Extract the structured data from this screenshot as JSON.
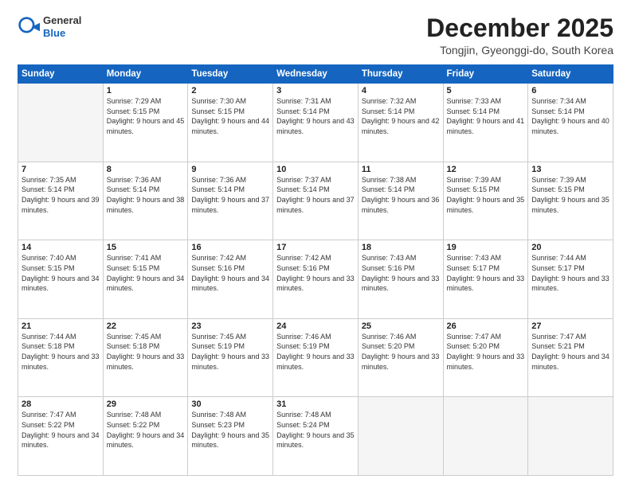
{
  "header": {
    "logo": {
      "general": "General",
      "blue": "Blue"
    },
    "title": "December 2025",
    "subtitle": "Tongjin, Gyeonggi-do, South Korea"
  },
  "calendar": {
    "days_of_week": [
      "Sunday",
      "Monday",
      "Tuesday",
      "Wednesday",
      "Thursday",
      "Friday",
      "Saturday"
    ],
    "weeks": [
      [
        {
          "num": "",
          "empty": true
        },
        {
          "num": "1",
          "sunrise": "Sunrise: 7:29 AM",
          "sunset": "Sunset: 5:15 PM",
          "daylight": "Daylight: 9 hours and 45 minutes."
        },
        {
          "num": "2",
          "sunrise": "Sunrise: 7:30 AM",
          "sunset": "Sunset: 5:15 PM",
          "daylight": "Daylight: 9 hours and 44 minutes."
        },
        {
          "num": "3",
          "sunrise": "Sunrise: 7:31 AM",
          "sunset": "Sunset: 5:14 PM",
          "daylight": "Daylight: 9 hours and 43 minutes."
        },
        {
          "num": "4",
          "sunrise": "Sunrise: 7:32 AM",
          "sunset": "Sunset: 5:14 PM",
          "daylight": "Daylight: 9 hours and 42 minutes."
        },
        {
          "num": "5",
          "sunrise": "Sunrise: 7:33 AM",
          "sunset": "Sunset: 5:14 PM",
          "daylight": "Daylight: 9 hours and 41 minutes."
        },
        {
          "num": "6",
          "sunrise": "Sunrise: 7:34 AM",
          "sunset": "Sunset: 5:14 PM",
          "daylight": "Daylight: 9 hours and 40 minutes."
        }
      ],
      [
        {
          "num": "7",
          "sunrise": "Sunrise: 7:35 AM",
          "sunset": "Sunset: 5:14 PM",
          "daylight": "Daylight: 9 hours and 39 minutes."
        },
        {
          "num": "8",
          "sunrise": "Sunrise: 7:36 AM",
          "sunset": "Sunset: 5:14 PM",
          "daylight": "Daylight: 9 hours and 38 minutes."
        },
        {
          "num": "9",
          "sunrise": "Sunrise: 7:36 AM",
          "sunset": "Sunset: 5:14 PM",
          "daylight": "Daylight: 9 hours and 37 minutes."
        },
        {
          "num": "10",
          "sunrise": "Sunrise: 7:37 AM",
          "sunset": "Sunset: 5:14 PM",
          "daylight": "Daylight: 9 hours and 37 minutes."
        },
        {
          "num": "11",
          "sunrise": "Sunrise: 7:38 AM",
          "sunset": "Sunset: 5:14 PM",
          "daylight": "Daylight: 9 hours and 36 minutes."
        },
        {
          "num": "12",
          "sunrise": "Sunrise: 7:39 AM",
          "sunset": "Sunset: 5:15 PM",
          "daylight": "Daylight: 9 hours and 35 minutes."
        },
        {
          "num": "13",
          "sunrise": "Sunrise: 7:39 AM",
          "sunset": "Sunset: 5:15 PM",
          "daylight": "Daylight: 9 hours and 35 minutes."
        }
      ],
      [
        {
          "num": "14",
          "sunrise": "Sunrise: 7:40 AM",
          "sunset": "Sunset: 5:15 PM",
          "daylight": "Daylight: 9 hours and 34 minutes."
        },
        {
          "num": "15",
          "sunrise": "Sunrise: 7:41 AM",
          "sunset": "Sunset: 5:15 PM",
          "daylight": "Daylight: 9 hours and 34 minutes."
        },
        {
          "num": "16",
          "sunrise": "Sunrise: 7:42 AM",
          "sunset": "Sunset: 5:16 PM",
          "daylight": "Daylight: 9 hours and 34 minutes."
        },
        {
          "num": "17",
          "sunrise": "Sunrise: 7:42 AM",
          "sunset": "Sunset: 5:16 PM",
          "daylight": "Daylight: 9 hours and 33 minutes."
        },
        {
          "num": "18",
          "sunrise": "Sunrise: 7:43 AM",
          "sunset": "Sunset: 5:16 PM",
          "daylight": "Daylight: 9 hours and 33 minutes."
        },
        {
          "num": "19",
          "sunrise": "Sunrise: 7:43 AM",
          "sunset": "Sunset: 5:17 PM",
          "daylight": "Daylight: 9 hours and 33 minutes."
        },
        {
          "num": "20",
          "sunrise": "Sunrise: 7:44 AM",
          "sunset": "Sunset: 5:17 PM",
          "daylight": "Daylight: 9 hours and 33 minutes."
        }
      ],
      [
        {
          "num": "21",
          "sunrise": "Sunrise: 7:44 AM",
          "sunset": "Sunset: 5:18 PM",
          "daylight": "Daylight: 9 hours and 33 minutes."
        },
        {
          "num": "22",
          "sunrise": "Sunrise: 7:45 AM",
          "sunset": "Sunset: 5:18 PM",
          "daylight": "Daylight: 9 hours and 33 minutes."
        },
        {
          "num": "23",
          "sunrise": "Sunrise: 7:45 AM",
          "sunset": "Sunset: 5:19 PM",
          "daylight": "Daylight: 9 hours and 33 minutes."
        },
        {
          "num": "24",
          "sunrise": "Sunrise: 7:46 AM",
          "sunset": "Sunset: 5:19 PM",
          "daylight": "Daylight: 9 hours and 33 minutes."
        },
        {
          "num": "25",
          "sunrise": "Sunrise: 7:46 AM",
          "sunset": "Sunset: 5:20 PM",
          "daylight": "Daylight: 9 hours and 33 minutes."
        },
        {
          "num": "26",
          "sunrise": "Sunrise: 7:47 AM",
          "sunset": "Sunset: 5:20 PM",
          "daylight": "Daylight: 9 hours and 33 minutes."
        },
        {
          "num": "27",
          "sunrise": "Sunrise: 7:47 AM",
          "sunset": "Sunset: 5:21 PM",
          "daylight": "Daylight: 9 hours and 34 minutes."
        }
      ],
      [
        {
          "num": "28",
          "sunrise": "Sunrise: 7:47 AM",
          "sunset": "Sunset: 5:22 PM",
          "daylight": "Daylight: 9 hours and 34 minutes."
        },
        {
          "num": "29",
          "sunrise": "Sunrise: 7:48 AM",
          "sunset": "Sunset: 5:22 PM",
          "daylight": "Daylight: 9 hours and 34 minutes."
        },
        {
          "num": "30",
          "sunrise": "Sunrise: 7:48 AM",
          "sunset": "Sunset: 5:23 PM",
          "daylight": "Daylight: 9 hours and 35 minutes."
        },
        {
          "num": "31",
          "sunrise": "Sunrise: 7:48 AM",
          "sunset": "Sunset: 5:24 PM",
          "daylight": "Daylight: 9 hours and 35 minutes."
        },
        {
          "num": "",
          "empty": true
        },
        {
          "num": "",
          "empty": true
        },
        {
          "num": "",
          "empty": true
        }
      ]
    ]
  }
}
